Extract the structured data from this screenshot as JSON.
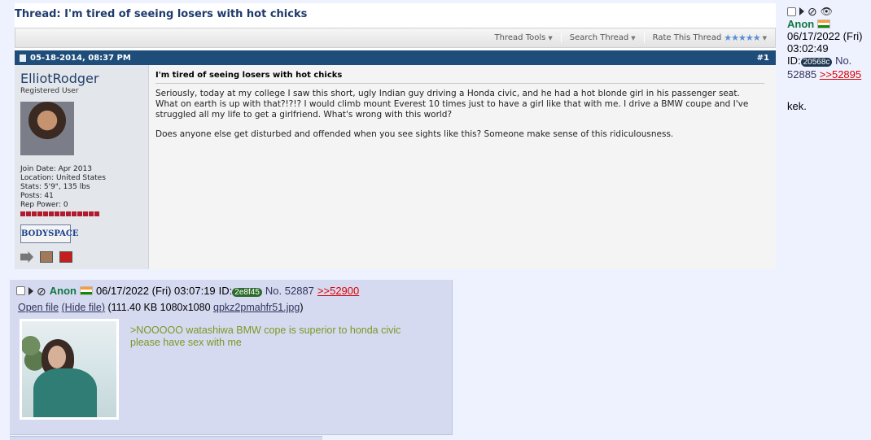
{
  "forum": {
    "thread_prefix": "Thread:",
    "thread_title": "I'm tired of seeing losers with hot chicks",
    "tools": [
      {
        "label": "Thread Tools"
      },
      {
        "label": "Search Thread"
      },
      {
        "label": "Rate This Thread",
        "stars": "★★★★★"
      }
    ],
    "post_date": "05-18-2014, 08:37 PM",
    "post_number": "#1",
    "username": "ElliotRodger",
    "user_title": "Registered User",
    "join_date": "Join Date: Apr 2013",
    "location": "Location: United States",
    "stats": "Stats: 5'9\", 135 lbs",
    "posts": "Posts: 41",
    "rep_power": "Rep Power: 0",
    "bodyspace_label": "BODYSPACE",
    "post_title": "I'm tired of seeing losers with hot chicks",
    "post_paragraph_1": "Seriously, today at my college I saw this short, ugly Indian guy driving a Honda civic, and he had a hot blonde girl in his passenger seat. What on earth is up with that?!?!? I would climb mount Everest 10 times just to have a girl like that with me. I drive a BMW coupe and I've struggled all my life to get a girlfriend. What's wrong with this world?",
    "post_paragraph_2": "Does anyone else get disturbed and offended when you see sights like this? Someone make sense of this ridiculousness."
  },
  "right_post": {
    "name": "Anon",
    "datetime": "06/17/2022 (Fri) 03:02:49",
    "id_label": "ID:",
    "poster_id": "20568c",
    "no_label": "No.",
    "post_no": "52885",
    "backlink": ">>52895",
    "message": "kek."
  },
  "reply_post": {
    "name": "Anon",
    "datetime": "06/17/2022 (Fri) 03:07:19",
    "id_label": "ID:",
    "poster_id": "2e8f45",
    "no_label": "No.",
    "post_no": "52887",
    "backlink": ">>52900",
    "open_file": "Open file",
    "hide_file": "(Hide file)",
    "file_meta": "(111.40 KB 1080x1080",
    "file_name": "qpkz2pmahfr51.jpg",
    "file_close": ")",
    "greentext_1": ">NOOOOO watashiwa BMW cope is superior to honda civic",
    "greentext_2": "please have sex with me"
  },
  "colors": {
    "background": "#eef2ff",
    "reply_bg": "#d6daf0",
    "name_green": "#117743",
    "quote_green": "#789922",
    "backlink_red": "#dd0000",
    "forum_header_blue": "#1f4d7a"
  }
}
